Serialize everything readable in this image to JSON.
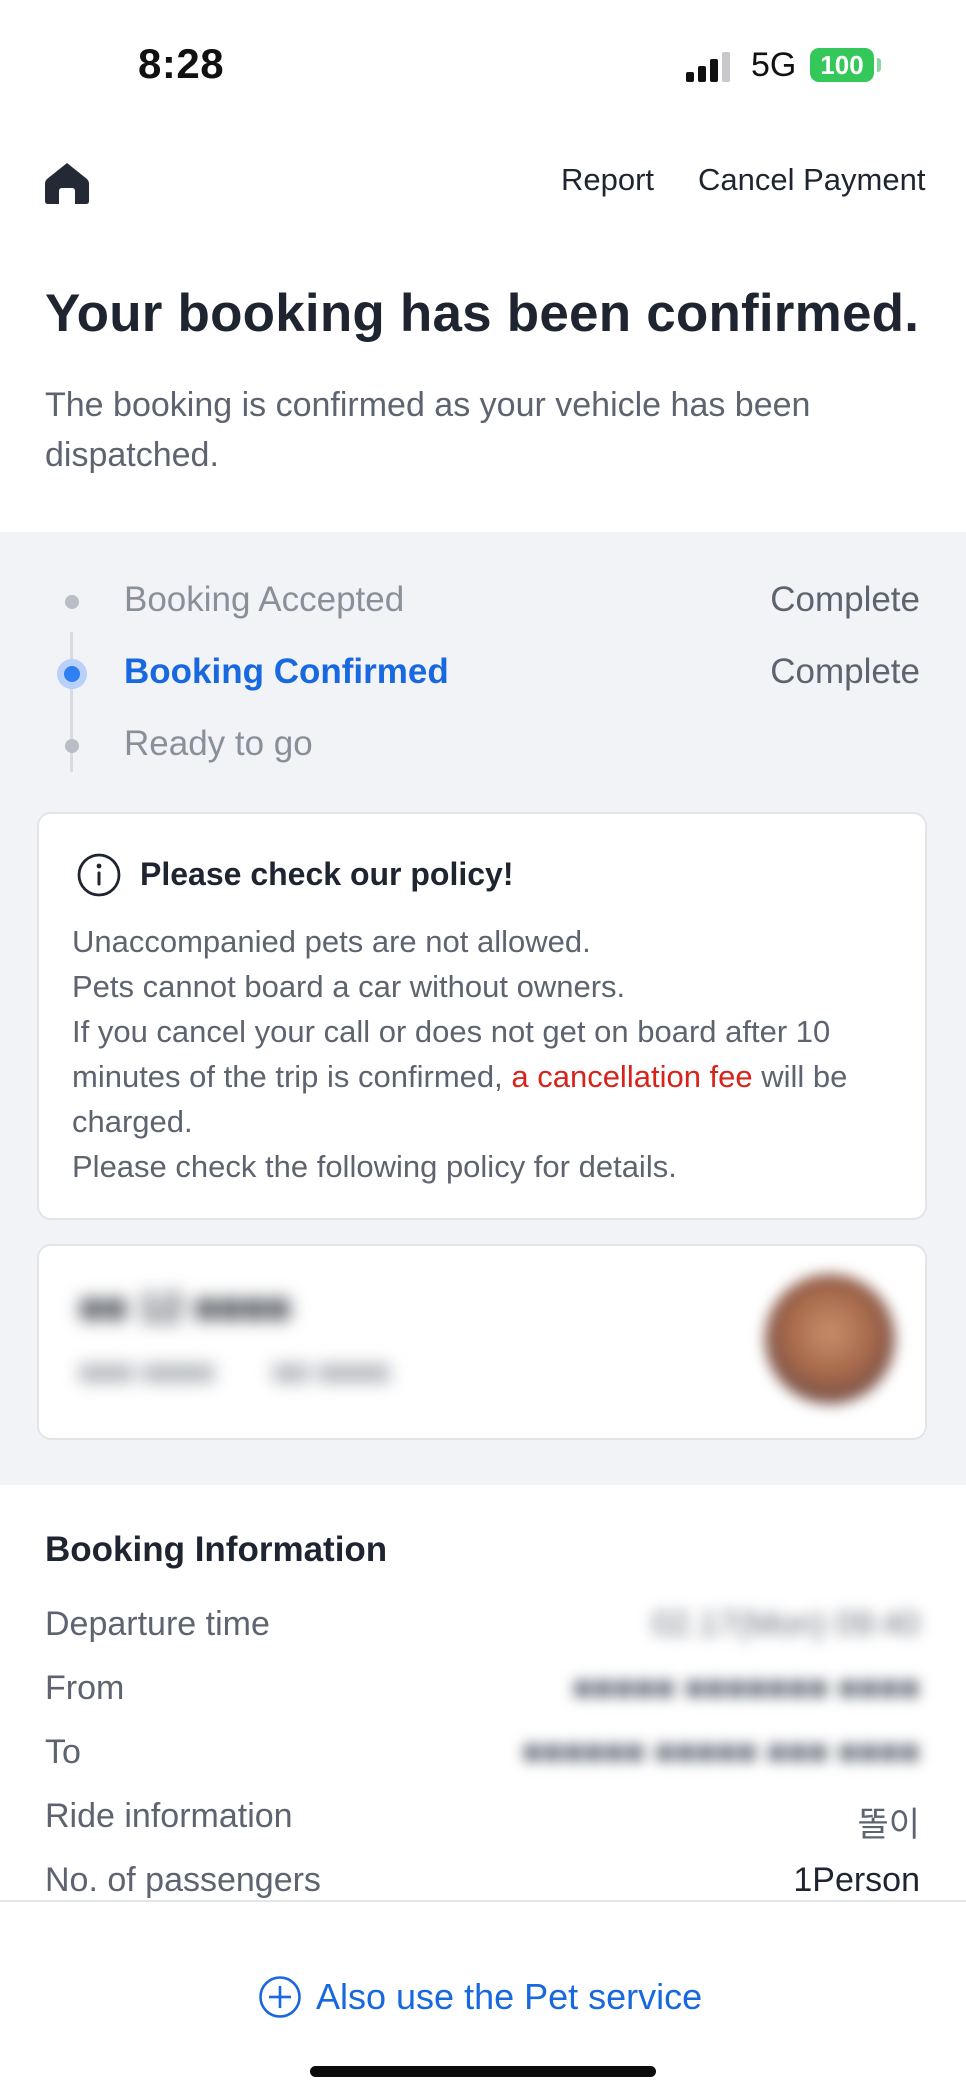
{
  "status_bar": {
    "time": "8:28",
    "network": "5G",
    "battery": "100"
  },
  "nav": {
    "home_icon": "home-icon",
    "report_label": "Report",
    "cancel_label": "Cancel Payment"
  },
  "header": {
    "title": "Your booking has been confirmed.",
    "subtitle": "The booking is confirmed as your vehicle has been dispatched."
  },
  "steps": [
    {
      "label": "Booking Accepted",
      "status": "Complete",
      "active": false
    },
    {
      "label": "Booking Confirmed",
      "status": "Complete",
      "active": true
    },
    {
      "label": "Ready to go",
      "status": "",
      "active": false
    }
  ],
  "policy": {
    "icon": "info-icon",
    "title": "Please check our policy!",
    "line1": "Unaccompanied pets are not allowed.",
    "line2": "Pets cannot board a car without owners.",
    "line3a": "If you cancel your call or does not get on board after 10 minutes of the trip is confirmed,",
    "line3_fee": "a cancellation fee",
    "line3b": "will be charged.",
    "line4": "Please check the following policy for details."
  },
  "driver": {
    "name": "■■ 12 ■■■■",
    "car": "■■■ ■■■■",
    "plate": "■■ ■■■■"
  },
  "booking_info": {
    "heading": "Booking Information",
    "rows": [
      {
        "label": "Departure time",
        "value": "02.17(Mon) 09:40",
        "blurred": true
      },
      {
        "label": "From",
        "value": "■■■■■ ■■■■■■■ ■■■■",
        "blurred": true
      },
      {
        "label": "To",
        "value": "■■■■■■ ■■■■■ ■■■ ■■■■",
        "blurred": true
      },
      {
        "label": "Ride information",
        "value": "똘이",
        "blurred": false
      },
      {
        "label": "No. of passengers",
        "value": "1Person",
        "blurred": false
      }
    ]
  },
  "bottom": {
    "pet_service_label": "Also use the Pet service",
    "icon": "plus-circle-icon"
  },
  "colors": {
    "accent": "#1868e0",
    "warning": "#d7241b",
    "battery": "#34c759",
    "section_bg": "#f2f3f6"
  }
}
